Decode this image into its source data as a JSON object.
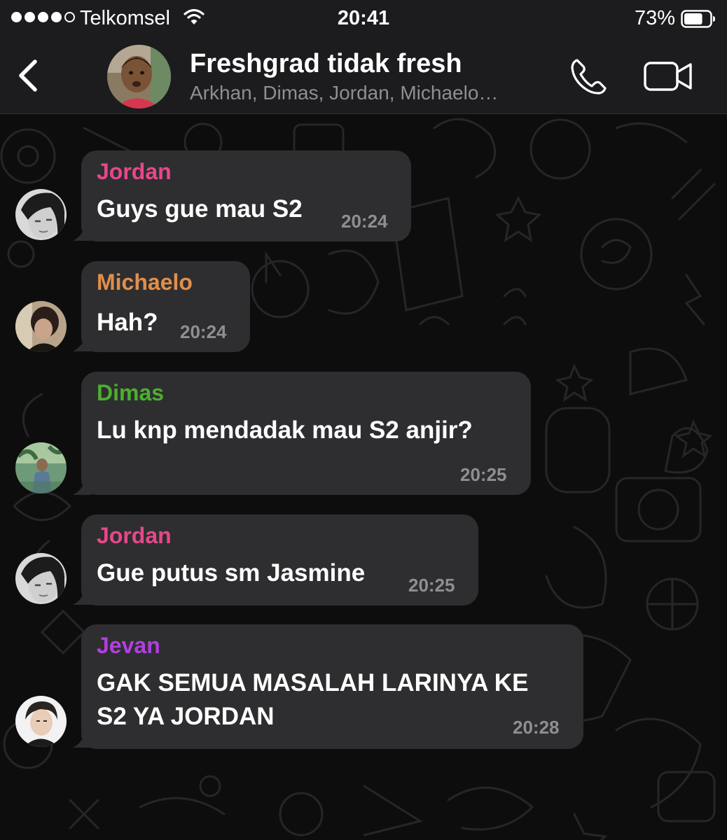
{
  "status_bar": {
    "carrier": "Telkomsel",
    "time": "20:41",
    "battery": "73%",
    "battery_level": 0.73,
    "signal_bars_filled": 4,
    "signal_bars_total": 5,
    "wifi_icon": "wifi-icon",
    "battery_icon": "battery-icon"
  },
  "header": {
    "back_icon": "chevron-left-icon",
    "title": "Freshgrad tidak fresh",
    "members": "Arkhan, Dimas, Jordan, Michaelo…",
    "call_icon": "phone-icon",
    "video_icon": "video-camera-icon"
  },
  "colors": {
    "bar_background": "#1c1c1e",
    "bubble": "#2e2e30",
    "muted_text": "#8e8e93",
    "jordan": "#e8478b",
    "michaelo": "#e08f4b",
    "dimas": "#4caf2e",
    "jevan": "#b23fe0"
  },
  "messages": [
    {
      "sender": "Jordan",
      "text": "Guys gue mau S2",
      "time": "20:24"
    },
    {
      "sender": "Michaelo",
      "text": "Hah?",
      "time": "20:24"
    },
    {
      "sender": "Dimas",
      "text": "Lu knp mendadak mau S2 anjir?",
      "time": "20:25"
    },
    {
      "sender": "Jordan",
      "text": "Gue putus sm Jasmine",
      "time": "20:25"
    },
    {
      "sender": "Jevan",
      "text_line1": "GAK SEMUA MASALAH LARINYA KE",
      "text_line2": "S2 YA JORDAN",
      "time": "20:28"
    }
  ]
}
